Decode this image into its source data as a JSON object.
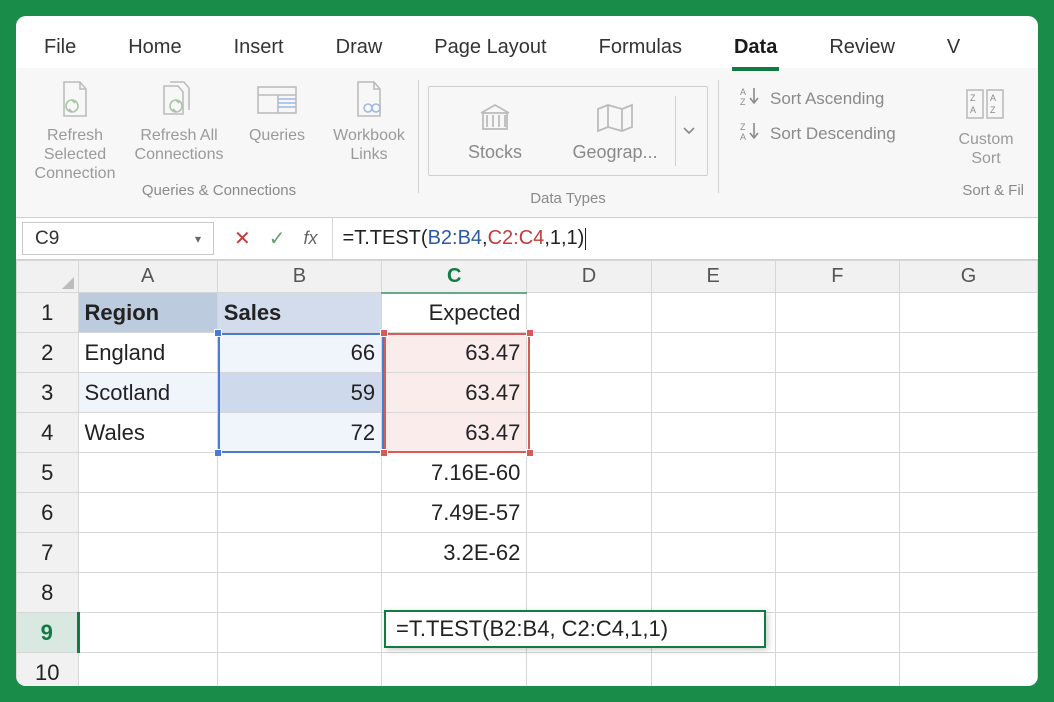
{
  "ribbon": {
    "tabs": [
      "File",
      "Home",
      "Insert",
      "Draw",
      "Page Layout",
      "Formulas",
      "Data",
      "Review",
      "V"
    ],
    "active_tab": "Data",
    "groups": {
      "queries": {
        "label": "Queries & Connections",
        "items": [
          {
            "label": "Refresh Selected Connection"
          },
          {
            "label": "Refresh All Connections"
          },
          {
            "label": "Queries"
          },
          {
            "label": "Workbook Links"
          }
        ]
      },
      "datatypes": {
        "label": "Data Types",
        "items": [
          {
            "label": "Stocks"
          },
          {
            "label": "Geograp..."
          }
        ]
      },
      "sort": {
        "label": "Sort & Fil",
        "asc": "Sort Ascending",
        "desc": "Sort Descending",
        "custom": "Custom Sort"
      }
    }
  },
  "formula_bar": {
    "name_box": "C9",
    "prefix": "=T.TEST(",
    "range1": "B2:B4",
    "sep1": ", ",
    "range2": "C2:C4",
    "suffix": ",1,1)"
  },
  "columns": [
    "A",
    "B",
    "C",
    "D",
    "E",
    "F",
    "G"
  ],
  "rows": [
    "1",
    "2",
    "3",
    "4",
    "5",
    "6",
    "7",
    "8",
    "9",
    "10"
  ],
  "active_col": "C",
  "active_row": "9",
  "cells": {
    "A1": "Region",
    "B1": "Sales",
    "C1": "Expected",
    "A2": "England",
    "B2": "66",
    "C2": "63.47",
    "A3": "Scotland",
    "B3": "59",
    "C3": "63.47",
    "A4": "Wales",
    "B4": "72",
    "C4": "63.47",
    "C5": "7.16E-60",
    "C6": "7.49E-57",
    "C7": "3.2E-62",
    "C9": "=T.TEST(B2:B4, C2:C4,1,1)"
  }
}
